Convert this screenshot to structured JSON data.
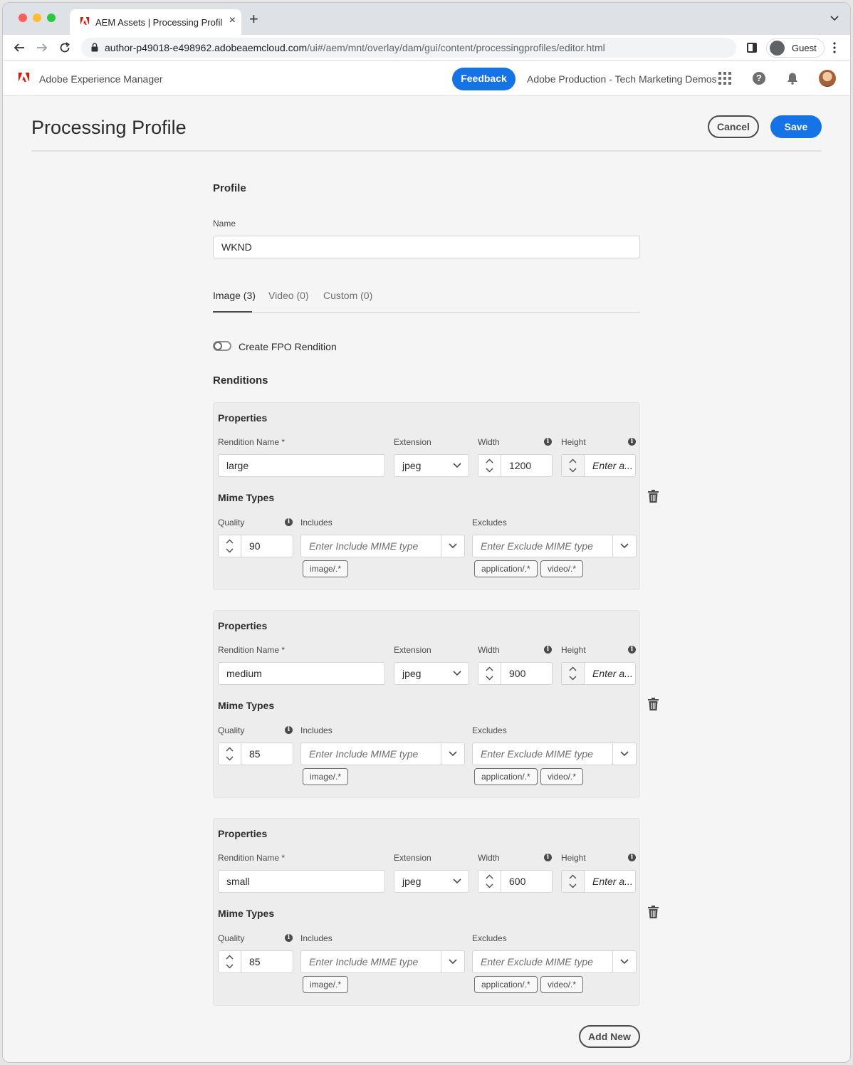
{
  "browser": {
    "tab_title": "AEM Assets | Processing Profil",
    "url_host": "author-p49018-e498962.adobeaemcloud.com",
    "url_path": "/ui#/aem/mnt/overlay/dam/gui/content/processingprofiles/editor.html",
    "profile_label": "Guest"
  },
  "header": {
    "product": "Adobe Experience Manager",
    "feedback": "Feedback",
    "org": "Adobe Production - Tech Marketing Demos"
  },
  "page": {
    "title": "Processing Profile",
    "cancel": "Cancel",
    "save": "Save"
  },
  "profile": {
    "section": "Profile",
    "name_label": "Name",
    "name_value": "WKND"
  },
  "tabs": [
    {
      "label": "Image (3)",
      "active": true
    },
    {
      "label": "Video (0)",
      "active": false
    },
    {
      "label": "Custom (0)",
      "active": false
    }
  ],
  "fpo": {
    "label": "Create FPO Rendition",
    "on": false
  },
  "renditions_title": "Renditions",
  "labels": {
    "properties": "Properties",
    "rendition_name": "Rendition Name *",
    "extension": "Extension",
    "width": "Width",
    "height": "Height",
    "height_placeholder": "Enter a...",
    "mime_types": "Mime Types",
    "quality": "Quality",
    "includes": "Includes",
    "excludes": "Excludes",
    "include_placeholder": "Enter Include MIME type",
    "exclude_placeholder": "Enter Exclude MIME type"
  },
  "renditions": [
    {
      "name": "large",
      "extension": "jpeg",
      "width": "1200",
      "quality": "90",
      "includes": [
        "image/.*"
      ],
      "excludes": [
        "application/.*",
        "video/.*"
      ]
    },
    {
      "name": "medium",
      "extension": "jpeg",
      "width": "900",
      "quality": "85",
      "includes": [
        "image/.*"
      ],
      "excludes": [
        "application/.*",
        "video/.*"
      ]
    },
    {
      "name": "small",
      "extension": "jpeg",
      "width": "600",
      "quality": "85",
      "includes": [
        "image/.*"
      ],
      "excludes": [
        "application/.*",
        "video/.*"
      ]
    }
  ],
  "add_new": "Add New",
  "colors": {
    "accent": "#1473e6",
    "adobe_red": "#eb1000"
  }
}
